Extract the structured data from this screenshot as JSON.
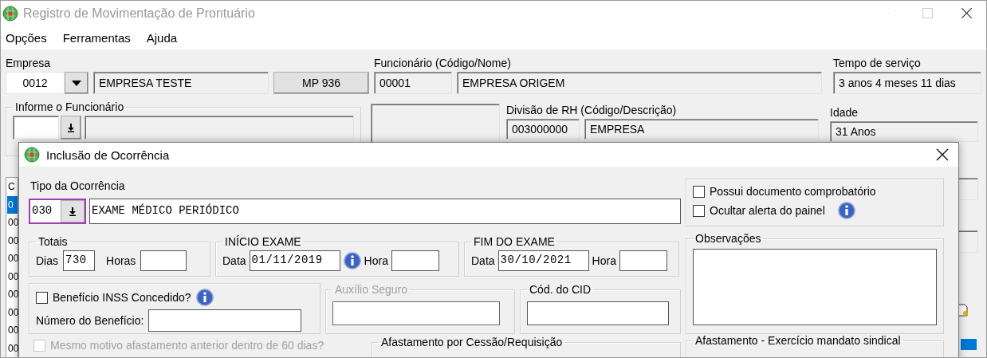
{
  "window": {
    "title": "Registro de Movimentação de Prontuário"
  },
  "menu": [
    {
      "label": "Opções"
    },
    {
      "label": "Ferramentas"
    },
    {
      "label": "Ajuda"
    }
  ],
  "empresa": {
    "label": "Empresa",
    "code": "0012",
    "name": "EMPRESA TESTE",
    "button": "MP 936"
  },
  "funcionario": {
    "label": "Funcionário (Código/Nome)",
    "code": "00001",
    "name": "EMPRESA ORIGEM"
  },
  "tempo_servico": {
    "label": "Tempo de serviço",
    "value": "3 anos 4 meses 11 dias"
  },
  "informe": {
    "label": "Informe o Funcionário"
  },
  "divisao": {
    "label": "Divisão de RH (Código/Descrição)",
    "code": "003000000",
    "name": "EMPRESA"
  },
  "idade": {
    "label": "Idade",
    "value": "31 Anos"
  },
  "list": {
    "header": "C",
    "rows": [
      {
        "text": "0",
        "selected": true
      },
      {
        "text": "00",
        "selected": false
      },
      {
        "text": "00",
        "selected": false
      },
      {
        "text": "00",
        "selected": false
      },
      {
        "text": "00",
        "selected": false
      },
      {
        "text": "00",
        "selected": false
      },
      {
        "text": "00",
        "selected": false
      },
      {
        "text": "00",
        "selected": false
      },
      {
        "text": "00",
        "selected": false
      }
    ]
  },
  "dialog": {
    "title": "Inclusão de Ocorrência",
    "tipo": {
      "label": "Tipo da Ocorrência",
      "code": "030",
      "description": "EXAME MÉDICO PERIÓDICO"
    },
    "checks": [
      {
        "label": "Possui documento comprobatório",
        "checked": false,
        "info": false
      },
      {
        "label": "Ocultar alerta do painel",
        "checked": false,
        "info": true
      }
    ],
    "totais": {
      "title": "Totais",
      "dias_label": "Dias",
      "dias": "730",
      "horas_label": "Horas"
    },
    "inicio": {
      "title": "INÍCIO EXAME",
      "data_label": "Data",
      "data": "01/11/2019",
      "hora_label": "Hora"
    },
    "fim": {
      "title": "FIM DO EXAME",
      "data_label": "Data",
      "data": "30/10/2021",
      "hora_label": "Hora"
    },
    "observacoes": {
      "title": "Observações"
    },
    "beneficio": {
      "label": "Benefício INSS Concedido?",
      "checked": false,
      "numero_label": "Número do Benefício:"
    },
    "auxilio": {
      "title": "Auxílio Seguro",
      "disabled": true
    },
    "cid": {
      "title": "Cód. do CID"
    },
    "mesmo_motivo": {
      "label": "Mesmo motivo afastamento anterior dentro de 60 dias?",
      "checked": false,
      "disabled": true
    },
    "cessao": {
      "title": "Afastamento por Cessão/Requisição"
    },
    "sindical": {
      "title": "Afastamento - Exercício mandato sindical"
    }
  }
}
